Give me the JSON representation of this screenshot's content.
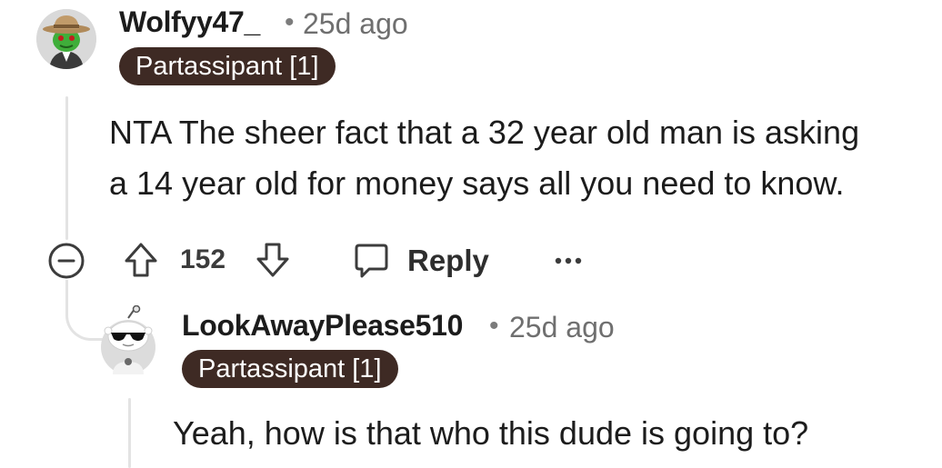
{
  "comment": {
    "username": "Wolfyy47_",
    "separator": "•",
    "time": "25d ago",
    "flair": "Partassipant [1]",
    "body_line1": "NTA The sheer fact that a 32 year old man is asking",
    "body_line2": "a 14 year old for money says all you need to know.",
    "vote_count": "152",
    "reply_label": "Reply",
    "more_label": "•••",
    "avatar_icon": "cowboy-avatar-icon"
  },
  "reply": {
    "username": "LookAwayPlease510",
    "separator": "•",
    "time": "25d ago",
    "flair": "Partassipant [1]",
    "body": "Yeah, how is that who this dude is going to?",
    "avatar_icon": "snoo-sunglasses-avatar-icon"
  },
  "colors": {
    "flair_bg": "#3e2a24",
    "flair_text": "#ffffff",
    "thread_line": "#e3e3e3",
    "icon": "#3c3c3c"
  }
}
